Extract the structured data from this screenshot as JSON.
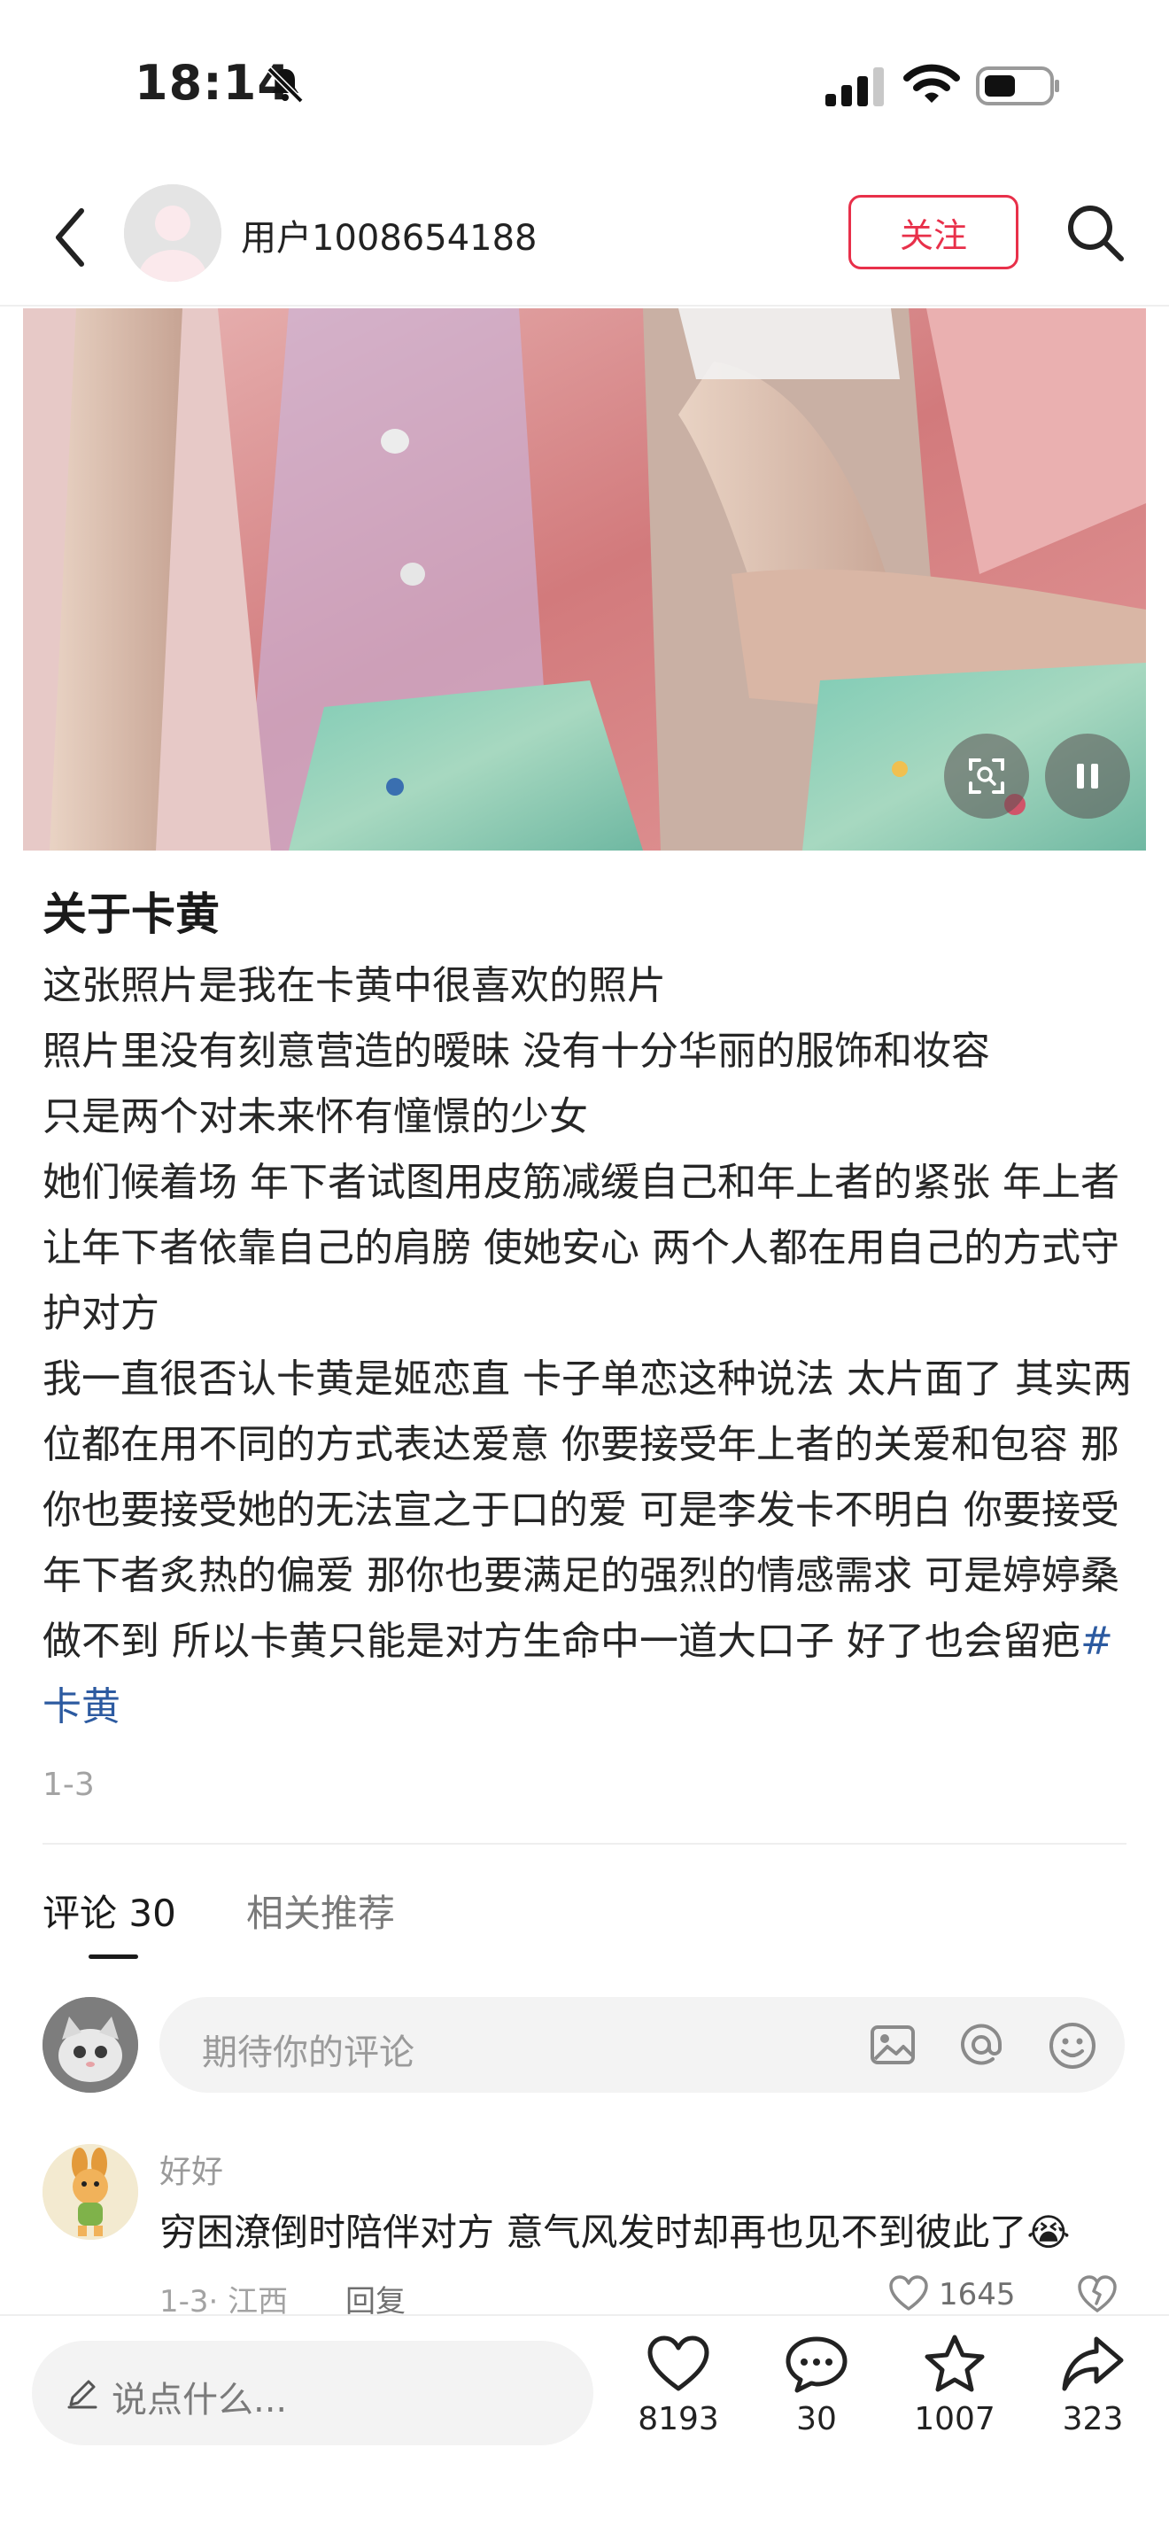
{
  "status_bar": {
    "time": "18:14"
  },
  "nav": {
    "author_name": "用户1008654188",
    "follow_label": "关注"
  },
  "post": {
    "title": "关于卡黄",
    "paragraphs": [
      "这张照片是我在卡黄中很喜欢的照片",
      "照片里没有刻意营造的暧昧 没有十分华丽的服饰和妆容",
      "只是两个对未来怀有憧憬的少女",
      "她们候着场 年下者试图用皮筋减缓自己和年上者的紧张 年上者让年下者依靠自己的肩膀 使她安心 两个人都在用自己的方式守护对方"
    ],
    "last_paragraph": "我一直很否认卡黄是姬恋直 卡子单恋这种说法 太片面了 其实两位都在用不同的方式表达爱意 你要接受年上者的关爱和包容 那你也要接受她的无法宣之于口的爱 可是李发卡不明白 你要接受年下者炙热的偏爱 那你也要满足的强烈的情感需求 可是婷婷桑做不到 所以卡黄只能是对方生命中一道大口子 好了也会留疤",
    "hashtag": "#卡黄",
    "date": "1-3"
  },
  "tabs": {
    "comments": "评论 30",
    "related": "相关推荐"
  },
  "comment_input": {
    "placeholder": "期待你的评论"
  },
  "comments": [
    {
      "user": "好好",
      "text": "穷困潦倒时陪伴对方 意气风发时却再也见不到彼此了😭",
      "meta": "1-3· 江西",
      "reply_label": "回复",
      "likes": "1645"
    }
  ],
  "bottom_bar": {
    "placeholder": "说点什么...",
    "like_count": "8193",
    "comment_count": "30",
    "collect_count": "1007",
    "share_count": "323"
  },
  "colors": {
    "accent": "#e8304a",
    "hashtag": "#2c5aa0"
  },
  "icons": [
    "bell-slash-icon",
    "signal-icon",
    "wifi-icon",
    "battery-icon",
    "back-icon",
    "search-icon",
    "scan-icon",
    "pause-icon",
    "image-icon",
    "at-icon",
    "emoji-icon",
    "heart-icon",
    "comment-icon",
    "star-icon",
    "share-icon",
    "pencil-icon",
    "dislike-icon"
  ]
}
